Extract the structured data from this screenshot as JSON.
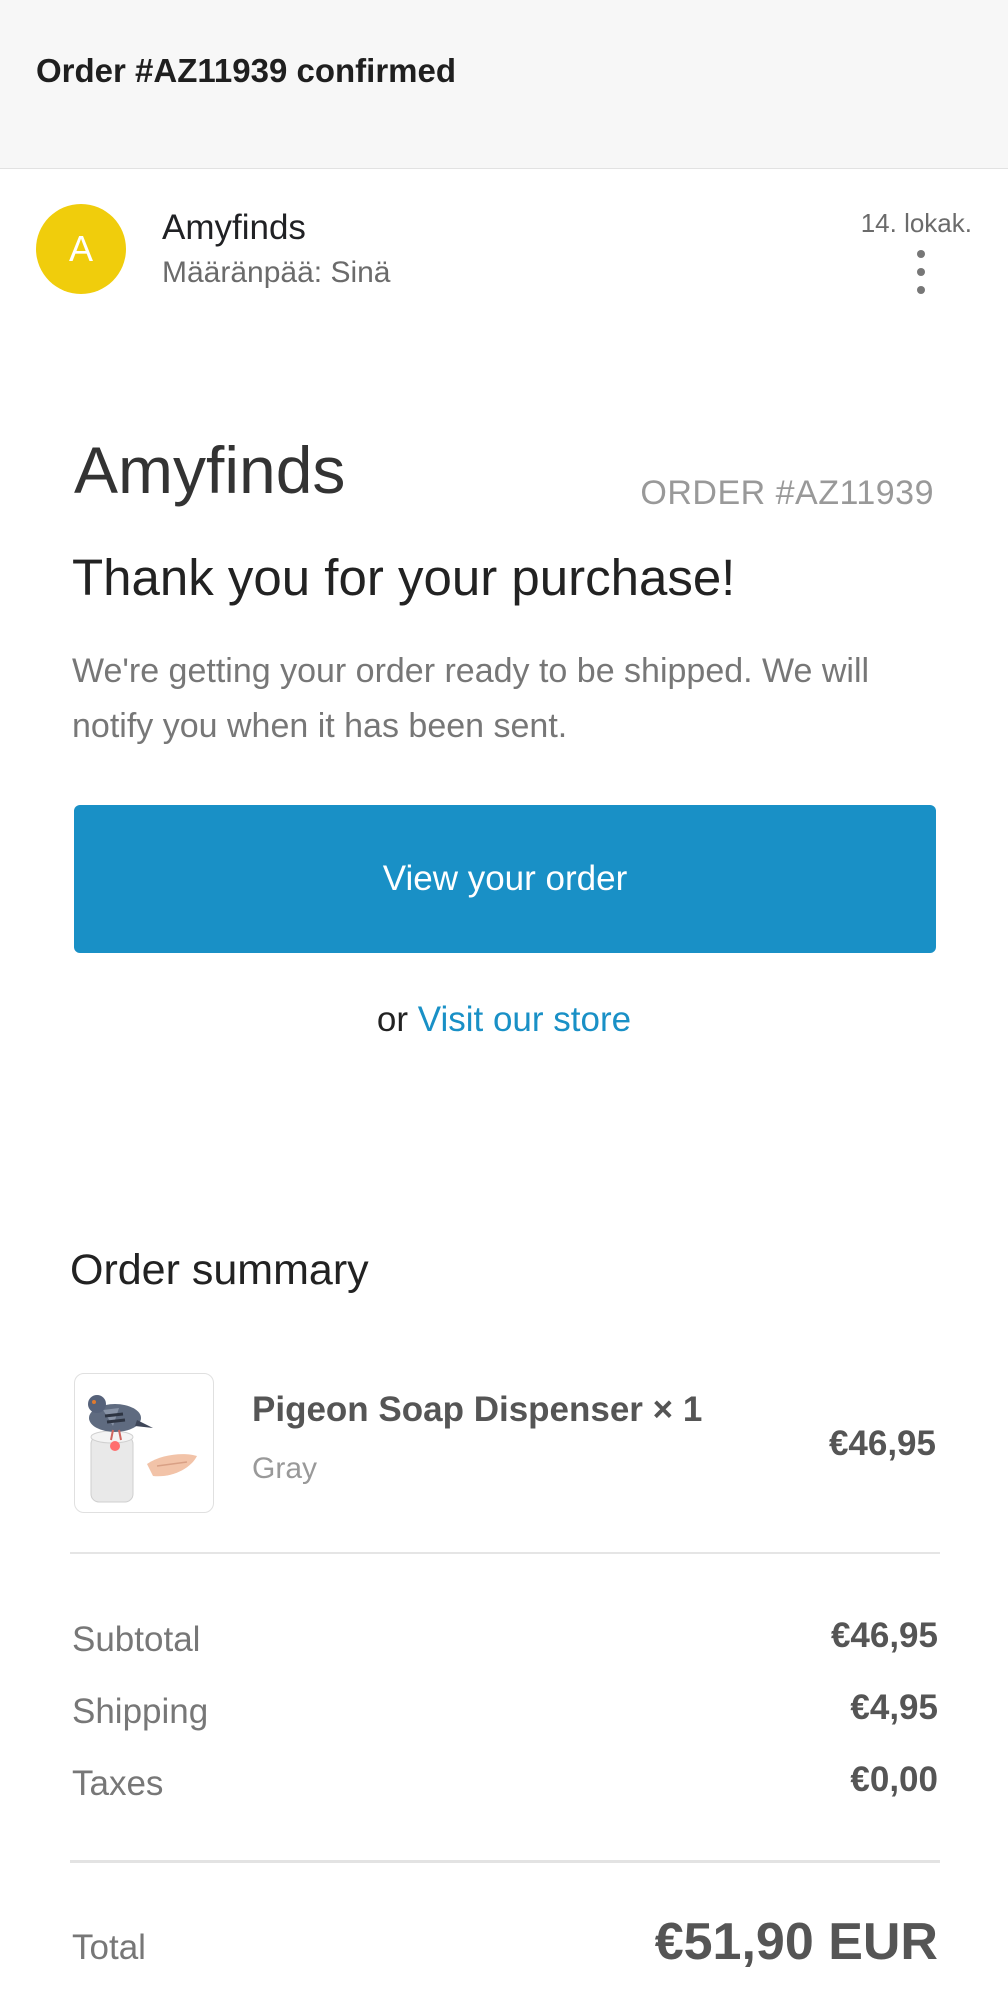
{
  "header": {
    "subject": "Order #AZ11939 confirmed"
  },
  "email": {
    "avatar_letter": "A",
    "sender": "Amyfinds",
    "recipient": "Määränpää: Sinä",
    "date": "14. lokak.",
    "avatar_color": "#f0cd0c"
  },
  "body": {
    "store_name": "Amyfinds",
    "order_number": "ORDER #AZ11939",
    "thanks": "Thank you for your purchase!",
    "message": "We're getting your order ready to be shipped. We will notify you when it has been sent.",
    "view_order_label": "View your order",
    "or_text": "or",
    "visit_store_label": "Visit our store",
    "accent_color": "#1990c6"
  },
  "summary": {
    "title": "Order summary",
    "item": {
      "name": "Pigeon Soap Dispenser × 1",
      "variant": "Gray",
      "price": "€46,95",
      "image_icon": "pigeon-soap-dispenser-image"
    },
    "rows": [
      {
        "label": "Subtotal",
        "value": "€46,95"
      },
      {
        "label": "Shipping",
        "value": "€4,95"
      },
      {
        "label": "Taxes",
        "value": "€0,00"
      }
    ],
    "total_label": "Total",
    "total_value": "€51,90 EUR"
  }
}
